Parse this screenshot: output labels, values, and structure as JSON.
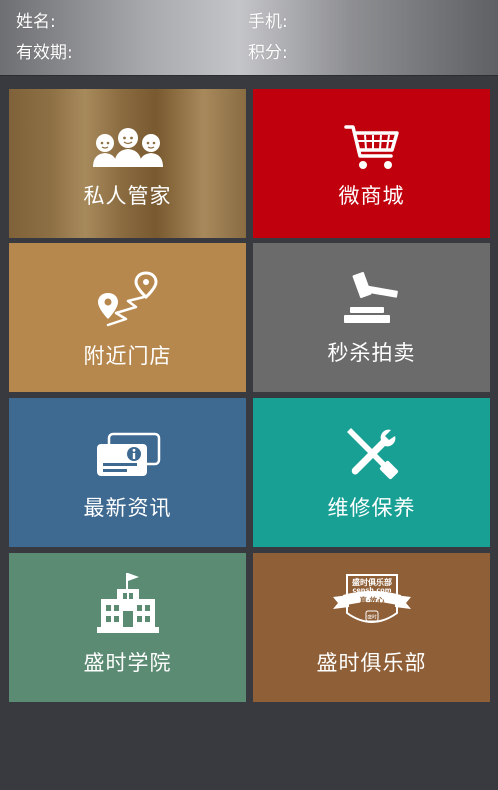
{
  "header": {
    "name_label": "姓名:",
    "phone_label": "手机:",
    "validity_label": "有效期:",
    "points_label": "积分:"
  },
  "menu": [
    {
      "label": "私人管家",
      "icon": "people-group-icon",
      "color": "#8a6b40"
    },
    {
      "label": "微商城",
      "icon": "shopping-cart-icon",
      "color": "#c1000d"
    },
    {
      "label": "附近门店",
      "icon": "map-route-pin-icon",
      "color": "#b7884e"
    },
    {
      "label": "秒杀拍卖",
      "icon": "auction-gavel-icon",
      "color": "#6b6b6c"
    },
    {
      "label": "最新资讯",
      "icon": "info-cards-icon",
      "color": "#3e6990"
    },
    {
      "label": "维修保养",
      "icon": "wrench-screwdriver-icon",
      "color": "#18a095"
    },
    {
      "label": "盛时学院",
      "icon": "school-building-icon",
      "color": "#5b8b73"
    },
    {
      "label": "盛时俱乐部",
      "icon": "club-badge-icon",
      "color": "#8f5f37"
    }
  ],
  "club_badge": {
    "top_text": "盛时俱乐部",
    "domain_text": "censh.com",
    "slogan": "真·放心",
    "bottom_text": "盛时"
  }
}
